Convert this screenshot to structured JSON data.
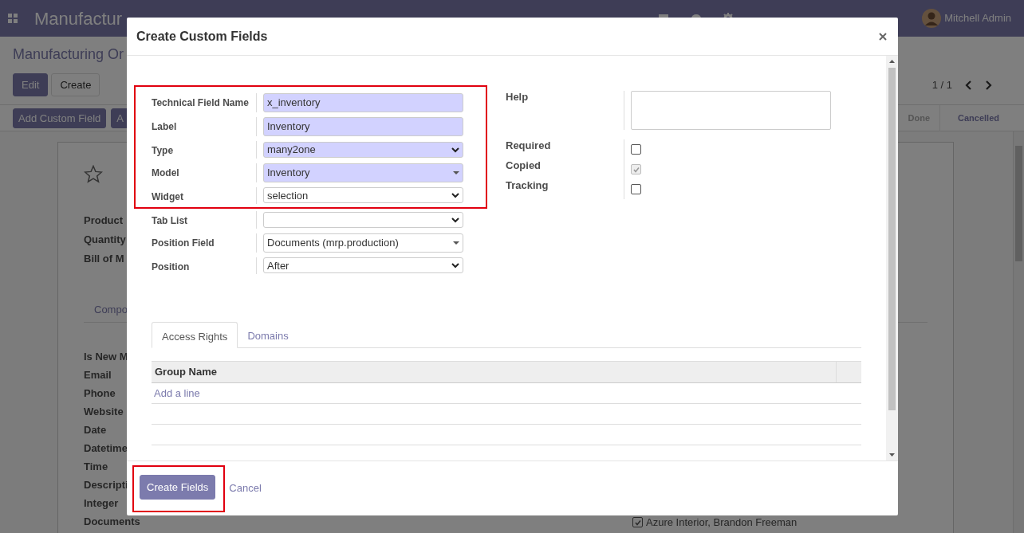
{
  "navbar": {
    "app_name": "Manufactur",
    "user": "Mitchell Admin"
  },
  "control_panel": {
    "breadcrumb": "Manufacturing Or",
    "buttons": [
      {
        "label": "Edit",
        "kind": "primary"
      },
      {
        "label": "Create",
        "kind": "secondary"
      }
    ],
    "pager": "1 / 1"
  },
  "action_bar": {
    "buttons": [
      "Add Custom Field",
      "A"
    ],
    "statusbar": [
      {
        "label": "Done",
        "selected": false
      },
      {
        "label": "Cancelled",
        "selected": true
      }
    ]
  },
  "record": {
    "starred": false,
    "fields": [
      "Product",
      "Quantity",
      "Bill of M"
    ],
    "tab": "Compo",
    "more_fields": [
      "Is New M",
      "Email",
      "Phone",
      "Website",
      "Date",
      "Datetime",
      "Time",
      "Descripti",
      "Integer",
      "Documents"
    ],
    "contact": {
      "options": [
        {
          "label": "Azure Interior, Brandon Freeman",
          "checked": true
        }
      ]
    }
  },
  "dialog": {
    "title": "Create Custom Fields",
    "left_fields": [
      {
        "label": "Technical Field Name",
        "kind": "input",
        "value": "x_inventory",
        "required": true,
        "outlined": true
      },
      {
        "label": "Label",
        "kind": "input",
        "value": "Inventory",
        "required": true,
        "outlined": true
      },
      {
        "label": "Type",
        "kind": "select",
        "value": "many2one",
        "required": true,
        "outlined": true
      },
      {
        "label": "Model",
        "kind": "many2one",
        "value": "Inventory",
        "required": true,
        "outlined": true
      },
      {
        "label": "Widget",
        "kind": "select",
        "value": "selection",
        "required": false,
        "outlined": true
      },
      {
        "label": "Tab List",
        "kind": "select",
        "required": false,
        "outlined": false
      },
      {
        "label": "Position Field",
        "kind": "many2one",
        "value": "Documents (mrp.production)",
        "required": false,
        "outlined": false
      },
      {
        "label": "Position",
        "kind": "select",
        "value": "After",
        "required": false,
        "outlined": false
      }
    ],
    "right_fields": [
      {
        "label": "Help",
        "kind": "textarea"
      },
      {
        "label": "Required",
        "kind": "checkbox",
        "checked": false,
        "disabled": false
      },
      {
        "label": "Copied",
        "kind": "checkbox",
        "checked": true,
        "disabled": true
      },
      {
        "label": "Tracking",
        "kind": "checkbox",
        "checked": false,
        "disabled": false
      }
    ],
    "tabs": [
      {
        "label": "Access Rights",
        "selected": true
      },
      {
        "label": "Domains",
        "selected": false
      }
    ],
    "table": {
      "columns": [
        "Group Name"
      ],
      "add_line": "Add a line"
    },
    "footer": {
      "primary": "Create Fields",
      "primary_outlined": true,
      "cancel": "Cancel"
    }
  }
}
